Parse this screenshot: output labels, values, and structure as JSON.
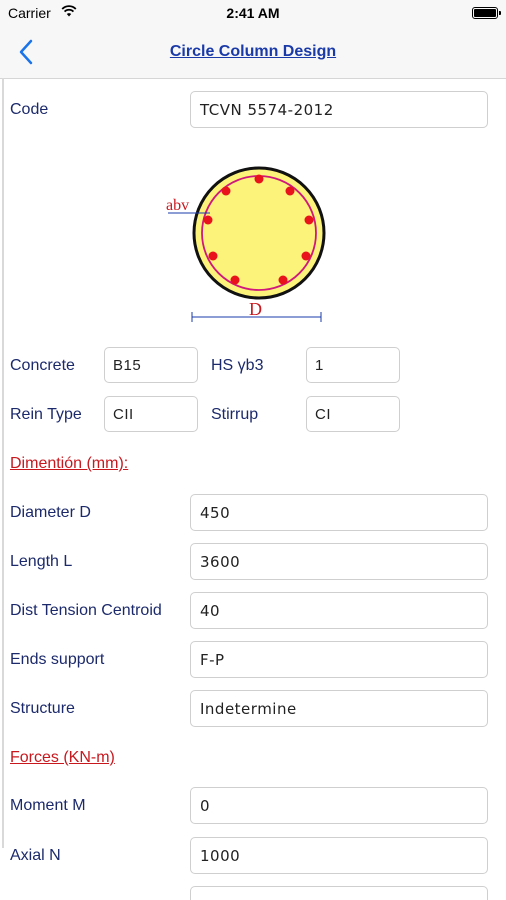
{
  "status": {
    "carrier": "Carrier",
    "time": "2:41 AM"
  },
  "nav": {
    "title": "Circle Column Design",
    "back_icon": "chevron-left-icon"
  },
  "code": {
    "label": "Code",
    "value": "TCVN 5574-2012"
  },
  "diagram": {
    "abv_label": "abv",
    "d_label": "D",
    "rebar_count": 10
  },
  "material": {
    "concrete_label": "Concrete",
    "concrete_value": "B15",
    "hs_label": "HS γb3",
    "hs_value": "1",
    "rein_label": "Rein Type",
    "rein_value": "CII",
    "stirrup_label": "Stirrup",
    "stirrup_value": "CI"
  },
  "dimension": {
    "heading": "Dimentión (mm):",
    "fields": [
      {
        "label": "Diameter D",
        "value": "450"
      },
      {
        "label": "Length L",
        "value": "3600"
      },
      {
        "label": "Dist Tension Centroid",
        "value": "40"
      },
      {
        "label": "Ends support",
        "value": "F-P"
      },
      {
        "label": "Structure",
        "value": "Indetermine"
      }
    ]
  },
  "forces": {
    "heading": "Forces (KN-m)",
    "fields": [
      {
        "label": "Moment M",
        "value": "0"
      },
      {
        "label": "Axial N",
        "value": "1000"
      }
    ]
  },
  "colors": {
    "accent": "#1a3aa8",
    "section": "#c8181e",
    "label": "#1c2a6b",
    "concrete_fill": "#fbf37a",
    "rebar": "#e8131b"
  }
}
